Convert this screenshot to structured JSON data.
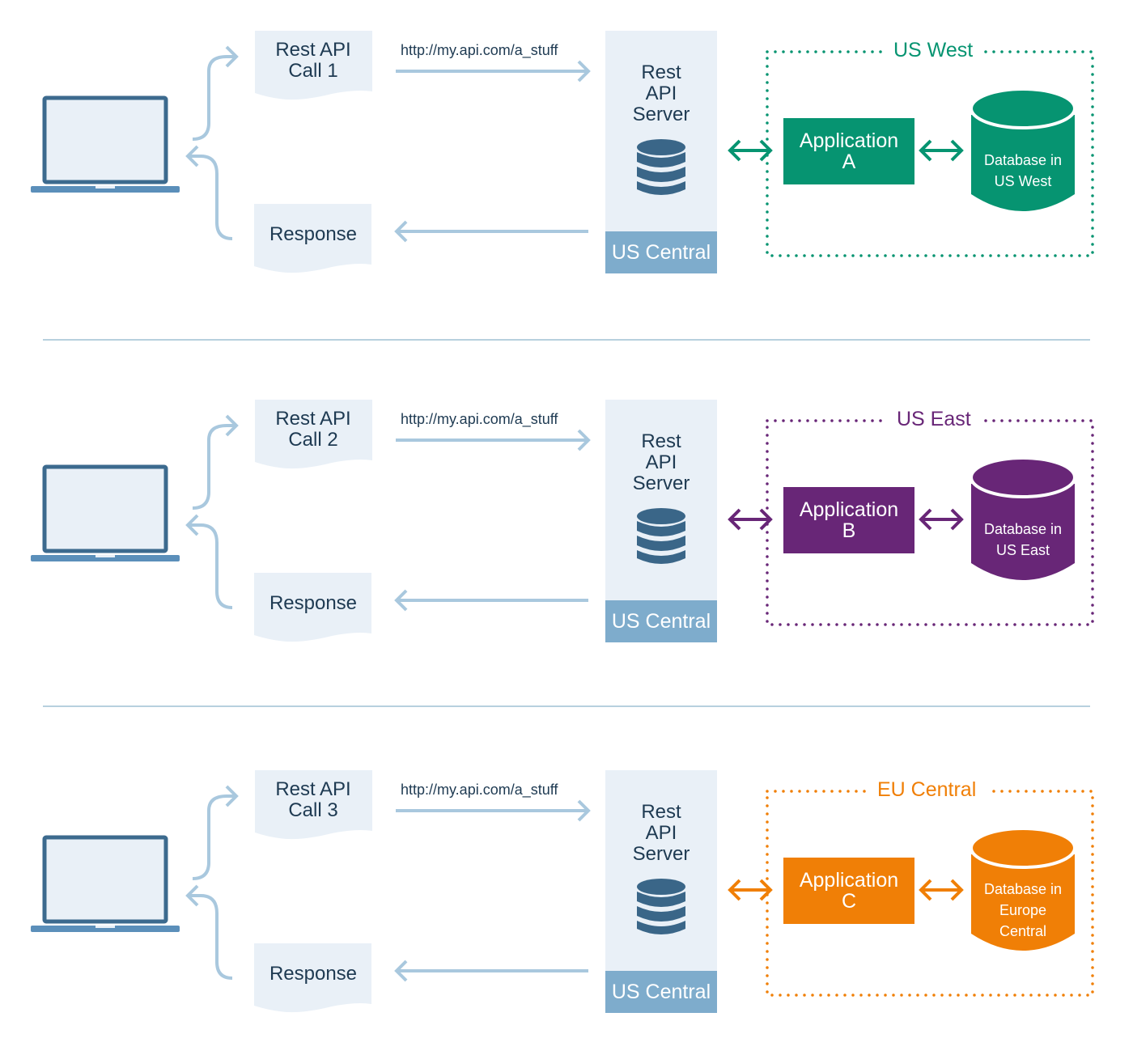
{
  "colors": {
    "doc_fill": "#e9f0f7",
    "arrow_light": "#a9c8de",
    "laptop_dark": "#3c6a8e",
    "laptop_base": "#5b8fba",
    "server_icon": "#3a6688",
    "server_region_bg": "#7eaccc",
    "divider": "#b7d0de"
  },
  "panels": [
    {
      "request": {
        "line1": "Rest API",
        "line2": "Call 1"
      },
      "url": "http://my.api.com/a_stuff",
      "response": "Response",
      "server": {
        "line1": "Rest",
        "line2": "API",
        "line3": "Server",
        "region": "US Central"
      },
      "region": {
        "title": "US West",
        "color": "#069471"
      },
      "application": {
        "line1": "Application",
        "line2": "A"
      },
      "database": {
        "line1": "Database in",
        "line2": "US West",
        "line3": ""
      }
    },
    {
      "request": {
        "line1": "Rest API",
        "line2": "Call 2"
      },
      "url": "http://my.api.com/a_stuff",
      "response": "Response",
      "server": {
        "line1": "Rest",
        "line2": "API",
        "line3": "Server",
        "region": "US Central"
      },
      "region": {
        "title": "US East",
        "color": "#682677"
      },
      "application": {
        "line1": "Application",
        "line2": "B"
      },
      "database": {
        "line1": "Database in",
        "line2": "US East",
        "line3": ""
      }
    },
    {
      "request": {
        "line1": "Rest API",
        "line2": "Call 3"
      },
      "url": "http://my.api.com/a_stuff",
      "response": "Response",
      "server": {
        "line1": "Rest",
        "line2": "API",
        "line3": "Server",
        "region": "US Central"
      },
      "region": {
        "title": "EU Central",
        "color": "#f07f06"
      },
      "application": {
        "line1": "Application",
        "line2": "C"
      },
      "database": {
        "line1": "Database in",
        "line2": "Europe",
        "line3": "Central"
      }
    }
  ]
}
